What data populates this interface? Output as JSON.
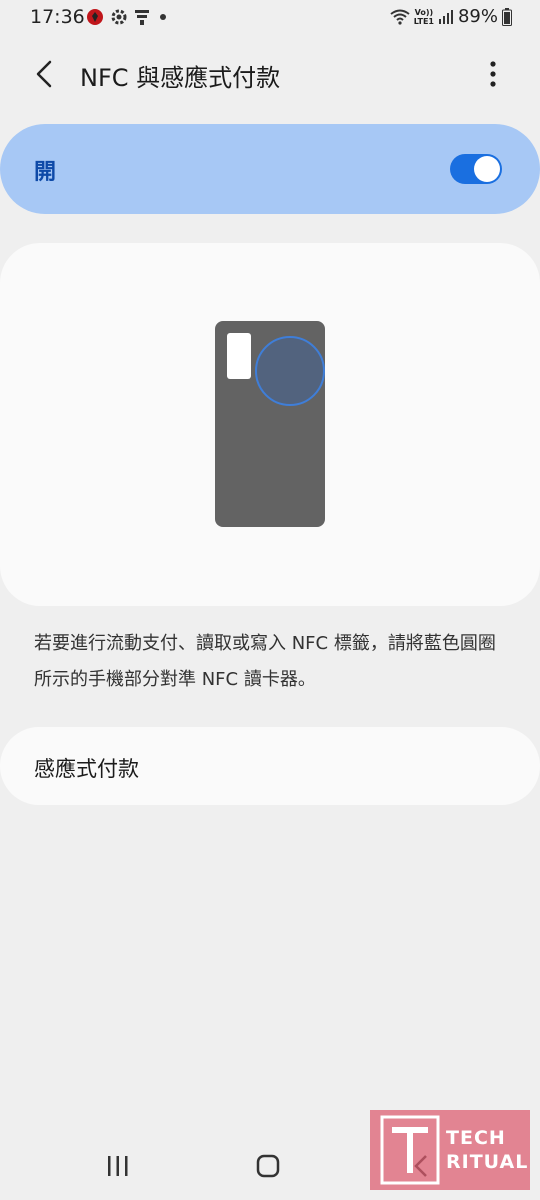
{
  "status_bar": {
    "time": "17:36",
    "battery": "89%",
    "network_top": "Vo))",
    "network_bottom": "LTE1",
    "icons": [
      "game-icon",
      "gear-icon",
      "notification-icon",
      "dot-icon",
      "wifi-icon",
      "signal-icon",
      "battery-icon"
    ]
  },
  "header": {
    "title": "NFC 與感應式付款",
    "icons": [
      "back-arrow-icon",
      "more-vert-icon"
    ]
  },
  "nfc_switch": {
    "label": "開",
    "state": "on",
    "color": "#1a6fe0"
  },
  "description": "若要進行流動支付、讀取或寫入 NFC 標籤，請將藍色圓圈所示的手機部分對準 NFC 讀卡器。",
  "tap_and_pay": {
    "label": "感應式付款"
  },
  "nav_bar": {
    "icons": [
      "recent-apps-icon",
      "home-icon",
      "back-icon"
    ]
  },
  "watermark": {
    "line1": "TECH",
    "line2": "RITUAL"
  },
  "colors": {
    "switch_bar_bg": "#a7c8f5",
    "switch_label": "#0e4aa8",
    "page_bg": "#efefef"
  }
}
